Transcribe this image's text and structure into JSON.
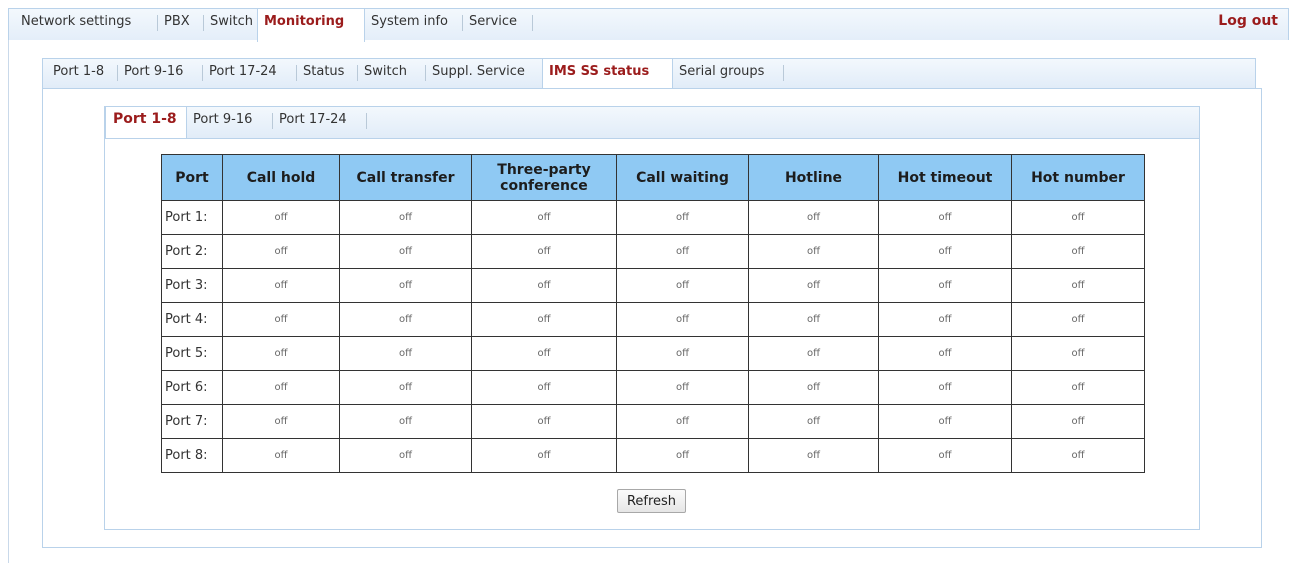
{
  "top_nav": {
    "tabs": [
      "Network settings",
      "PBX",
      "Switch",
      "Monitoring",
      "System info",
      "Service"
    ],
    "active": "Monitoring",
    "logout": "Log out"
  },
  "sub_nav": {
    "tabs": [
      "Port 1-8",
      "Port 9-16",
      "Port 17-24",
      "Status",
      "Switch",
      "Suppl. Service",
      "IMS SS status",
      "Serial groups"
    ],
    "active": "IMS SS status"
  },
  "inner_nav": {
    "tabs": [
      "Port 1-8",
      "Port 9-16",
      "Port 17-24"
    ],
    "active": "Port 1-8"
  },
  "table": {
    "headers": [
      "Port",
      "Call hold",
      "Call transfer",
      "Three-party conference",
      "Call waiting",
      "Hotline",
      "Hot timeout",
      "Hot number"
    ],
    "rows": [
      {
        "port": "Port 1:",
        "values": [
          "off",
          "off",
          "off",
          "off",
          "off",
          "off",
          "off"
        ]
      },
      {
        "port": "Port 2:",
        "values": [
          "off",
          "off",
          "off",
          "off",
          "off",
          "off",
          "off"
        ]
      },
      {
        "port": "Port 3:",
        "values": [
          "off",
          "off",
          "off",
          "off",
          "off",
          "off",
          "off"
        ]
      },
      {
        "port": "Port 4:",
        "values": [
          "off",
          "off",
          "off",
          "off",
          "off",
          "off",
          "off"
        ]
      },
      {
        "port": "Port 5:",
        "values": [
          "off",
          "off",
          "off",
          "off",
          "off",
          "off",
          "off"
        ]
      },
      {
        "port": "Port 6:",
        "values": [
          "off",
          "off",
          "off",
          "off",
          "off",
          "off",
          "off"
        ]
      },
      {
        "port": "Port 7:",
        "values": [
          "off",
          "off",
          "off",
          "off",
          "off",
          "off",
          "off"
        ]
      },
      {
        "port": "Port 8:",
        "values": [
          "off",
          "off",
          "off",
          "off",
          "off",
          "off",
          "off"
        ]
      }
    ]
  },
  "refresh_label": "Refresh",
  "colors": {
    "active_tab_text": "#9b1c1c",
    "table_header_bg": "#8fc9f3",
    "border": "#b9d2ea"
  }
}
